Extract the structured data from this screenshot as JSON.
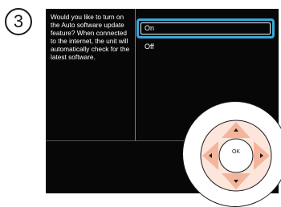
{
  "step": {
    "number": "3"
  },
  "screen": {
    "question": "Would you like to turn on the Auto software update feature?  When connected to the internet, the unit will automatically check for the latest software.",
    "options": [
      {
        "label": "On",
        "selected": true
      },
      {
        "label": "Off",
        "selected": false
      }
    ],
    "highlight_color": "#3aa8d8"
  },
  "remote": {
    "center_label": "OK",
    "arrow_color": "#f4b59d",
    "arrows": [
      "up-arrow-icon",
      "down-arrow-icon",
      "left-arrow-icon",
      "right-arrow-icon"
    ]
  }
}
